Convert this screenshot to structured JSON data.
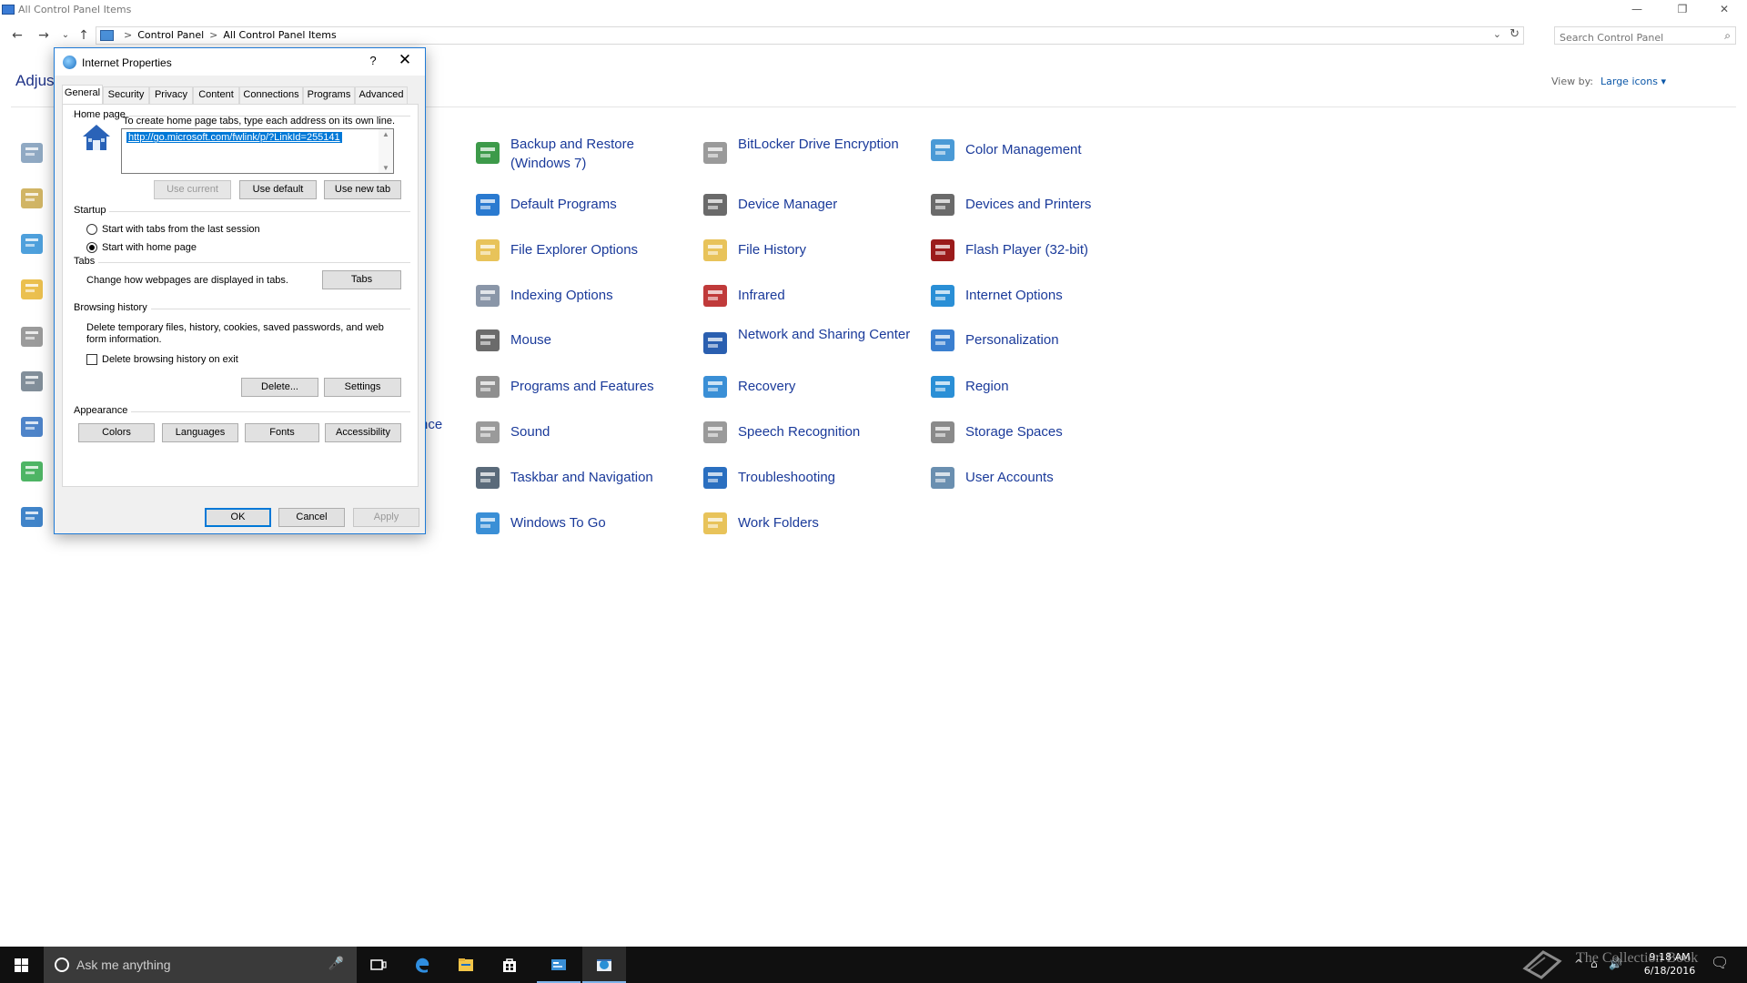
{
  "window": {
    "title": "All Control Panel Items",
    "minimize_glyph": "—",
    "restore_glyph": "❐",
    "close_glyph": "✕"
  },
  "address": {
    "back_glyph": "←",
    "forward_glyph": "→",
    "recent_glyph": "⌄",
    "up_glyph": "↑",
    "sep_glyph": ">",
    "crumbs": [
      "Control Panel",
      "All Control Panel Items"
    ],
    "dropdown_glyph": "⌄",
    "refresh_glyph": "↻"
  },
  "search": {
    "placeholder": "Search Control Panel",
    "icon_glyph": "⌕"
  },
  "main": {
    "adjust_title": "Adjust",
    "view_by_label": "View by:",
    "view_by_value": "Large icons ▾",
    "partial_label": "nce"
  },
  "left_icons": [
    {
      "name": "administrative-tools-icon",
      "color": "#7d9ab8"
    },
    {
      "name": "autoplay-icon",
      "color": "#c9a84a"
    },
    {
      "name": "display-icon",
      "color": "#2f8fd6"
    },
    {
      "name": "fonts-icon",
      "color": "#e8b530"
    },
    {
      "name": "keyboard-icon",
      "color": "#8a8a8a"
    },
    {
      "name": "phone-modem-icon",
      "color": "#6c7b88"
    },
    {
      "name": "remoteapp-icon",
      "color": "#2f6fc0"
    },
    {
      "name": "sync-center-icon",
      "color": "#2fa84a"
    },
    {
      "name": "windows-defender-icon",
      "color": "#1f6fc0"
    }
  ],
  "control_panel_items": [
    [
      {
        "label": "Backup and Restore (Windows 7)",
        "icon": "backup-restore-icon",
        "color": "#3d9a4a"
      },
      {
        "label": "Default Programs",
        "icon": "default-programs-icon",
        "color": "#2a7ad0"
      },
      {
        "label": "File Explorer Options",
        "icon": "file-explorer-options-icon",
        "color": "#e8c35a"
      },
      {
        "label": "Indexing Options",
        "icon": "indexing-options-icon",
        "color": "#8a96a8"
      },
      {
        "label": "Mouse",
        "icon": "mouse-icon",
        "color": "#6b6b6b"
      },
      {
        "label": "Programs and Features",
        "icon": "programs-features-icon",
        "color": "#8f8f8f"
      },
      {
        "label": "Sound",
        "icon": "sound-icon",
        "color": "#9a9a9a"
      },
      {
        "label": "Taskbar and Navigation",
        "icon": "taskbar-navigation-icon",
        "color": "#5a6a7a"
      },
      {
        "label": "Windows To Go",
        "icon": "windows-to-go-icon",
        "color": "#3a8fd6"
      }
    ],
    [
      {
        "label": "BitLocker Drive Encryption",
        "icon": "bitlocker-icon",
        "color": "#9a9a9a"
      },
      {
        "label": "Device Manager",
        "icon": "device-manager-icon",
        "color": "#6a6a6a"
      },
      {
        "label": "File History",
        "icon": "file-history-icon",
        "color": "#e8c35a"
      },
      {
        "label": "Infrared",
        "icon": "infrared-icon",
        "color": "#c03a3a"
      },
      {
        "label": "Network and Sharing Center",
        "icon": "network-sharing-icon",
        "color": "#2a5fb0"
      },
      {
        "label": "Recovery",
        "icon": "recovery-icon",
        "color": "#3a8fd6"
      },
      {
        "label": "Speech Recognition",
        "icon": "speech-recognition-icon",
        "color": "#9a9a9a"
      },
      {
        "label": "Troubleshooting",
        "icon": "troubleshooting-icon",
        "color": "#2a6fc0"
      },
      {
        "label": "Work Folders",
        "icon": "work-folders-icon",
        "color": "#e8c35a"
      }
    ],
    [
      {
        "label": "Color Management",
        "icon": "color-management-icon",
        "color": "#4a9ad6"
      },
      {
        "label": "Devices and Printers",
        "icon": "devices-printers-icon",
        "color": "#6a6a6a"
      },
      {
        "label": "Flash Player (32-bit)",
        "icon": "flash-player-icon",
        "color": "#9b1b1b"
      },
      {
        "label": "Internet Options",
        "icon": "internet-options-icon",
        "color": "#2a8fd6"
      },
      {
        "label": "Personalization",
        "icon": "personalization-icon",
        "color": "#3a7fd0"
      },
      {
        "label": "Region",
        "icon": "region-icon",
        "color": "#2a8fd6"
      },
      {
        "label": "Storage Spaces",
        "icon": "storage-spaces-icon",
        "color": "#8a8a8a"
      },
      {
        "label": "User Accounts",
        "icon": "user-accounts-icon",
        "color": "#6a8fb0"
      }
    ]
  ],
  "dialog": {
    "title": "Internet Properties",
    "help_glyph": "?",
    "close_glyph": "✕",
    "tabs": [
      "General",
      "Security",
      "Privacy",
      "Content",
      "Connections",
      "Programs",
      "Advanced"
    ],
    "home_page": {
      "group_label": "Home page",
      "instruction": "To create home page tabs, type each address on its own line.",
      "url": "http://go.microsoft.com/fwlink/p/?LinkId=255141",
      "use_current": "Use current",
      "use_default": "Use default",
      "use_new_tab": "Use new tab"
    },
    "startup": {
      "group_label": "Startup",
      "option_last_session": "Start with tabs from the last session",
      "option_home_page": "Start with home page"
    },
    "tabs_group": {
      "group_label": "Tabs",
      "description": "Change how webpages are displayed in tabs.",
      "button": "Tabs"
    },
    "browsing_history": {
      "group_label": "Browsing history",
      "description_1": "Delete temporary files, history, cookies, saved passwords, and web",
      "description_2": "form information.",
      "checkbox_label": "Delete browsing history on exit",
      "delete_button": "Delete...",
      "settings_button": "Settings"
    },
    "appearance": {
      "group_label": "Appearance",
      "colors": "Colors",
      "languages": "Languages",
      "fonts": "Fonts",
      "accessibility": "Accessibility"
    },
    "ok": "OK",
    "cancel": "Cancel",
    "apply": "Apply"
  },
  "taskbar": {
    "search_placeholder": "Ask me anything",
    "mic_glyph": "🎤",
    "time": "9:18 AM",
    "date": "6/18/2016",
    "tray_up_glyph": "^",
    "tray_network_glyph": "⌂",
    "tray_volume_glyph": "🔊",
    "notification_glyph": "🗨",
    "watermark": "The Collection Book"
  }
}
